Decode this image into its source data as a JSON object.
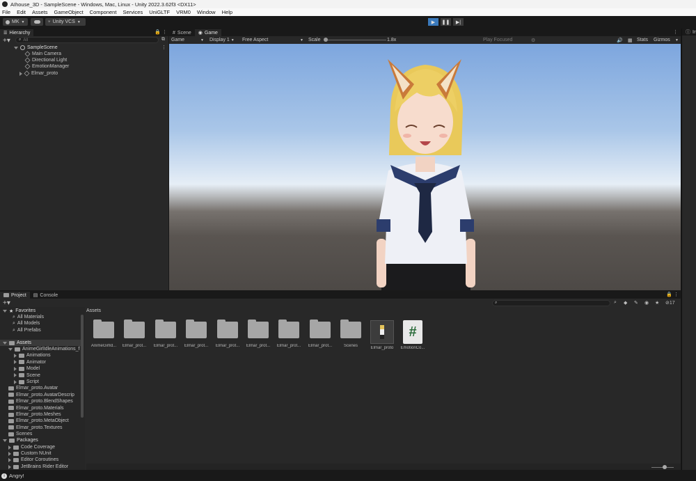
{
  "window": {
    "title": "AIhouse_3D - SampleScene - Windows, Mac, Linux - Unity 2022.3.62f3 <DX11>"
  },
  "menu": [
    "File",
    "Edit",
    "Assets",
    "GameObject",
    "Component",
    "Services",
    "UniGLTF",
    "VRM0",
    "Window",
    "Help"
  ],
  "toolbar": {
    "account": "MK",
    "vcs": "Unity VCS"
  },
  "hierarchy": {
    "tab": "Hierarchy",
    "search_placeholder": "All",
    "scene": "SampleScene",
    "items": [
      "Main Camera",
      "Directional Light",
      "EmotionManager",
      "Elmar_proto"
    ]
  },
  "scene_tabs": {
    "scene": "Scene",
    "game": "Game"
  },
  "game_bar": {
    "mode": "Game",
    "display": "Display 1",
    "aspect": "Free Aspect",
    "scale_label": "Scale",
    "scale_value": "1.8x",
    "play_mode": "Play Focused",
    "stats": "Stats",
    "gizmos": "Gizmos"
  },
  "inspector_tab": "In",
  "bottom_tabs": {
    "project": "Project",
    "console": "Console"
  },
  "project": {
    "breadcrumb": "Assets",
    "favorites_label": "Favorites",
    "favorites": [
      "All Materials",
      "All Models",
      "All Prefabs"
    ],
    "assets_label": "Assets",
    "tree": [
      {
        "label": "AnimeGirlIdleAnimations_f",
        "depth": 1,
        "expand": true
      },
      {
        "label": "Animations",
        "depth": 2
      },
      {
        "label": "Animator",
        "depth": 2
      },
      {
        "label": "Model",
        "depth": 2
      },
      {
        "label": "Scene",
        "depth": 2
      },
      {
        "label": "Script",
        "depth": 2
      },
      {
        "label": "Elmar_proto.Avatar",
        "depth": 1
      },
      {
        "label": "Elmar_proto.AvatarDescrip",
        "depth": 1
      },
      {
        "label": "Elmar_proto.BlendShapes",
        "depth": 1
      },
      {
        "label": "Elmar_proto.Materials",
        "depth": 1
      },
      {
        "label": "Elmar_proto.Meshes",
        "depth": 1
      },
      {
        "label": "Elmar_proto.MetaObject",
        "depth": 1
      },
      {
        "label": "Elmar_proto.Textures",
        "depth": 1
      },
      {
        "label": "Scenes",
        "depth": 1
      }
    ],
    "packages_label": "Packages",
    "packages": [
      "Code Coverage",
      "Custom NUnit",
      "Editor Coroutines",
      "JetBrains Rider Editor"
    ],
    "grid": [
      "AnimeGirlId...",
      "Elmar_prot...",
      "Elmar_prot...",
      "Elmar_prot...",
      "Elmar_prot...",
      "Elmar_prot...",
      "Elmar_prot...",
      "Elmar_prot...",
      "Scenes",
      "Elmar_proto",
      "EmotionCo..."
    ],
    "count": "17"
  },
  "status": {
    "message": "Angry!"
  },
  "colors": {
    "accent": "#3a79bb",
    "panel": "#282828",
    "bg": "#191919",
    "sky_top": "#7da6de",
    "floor": "#5a5551"
  }
}
